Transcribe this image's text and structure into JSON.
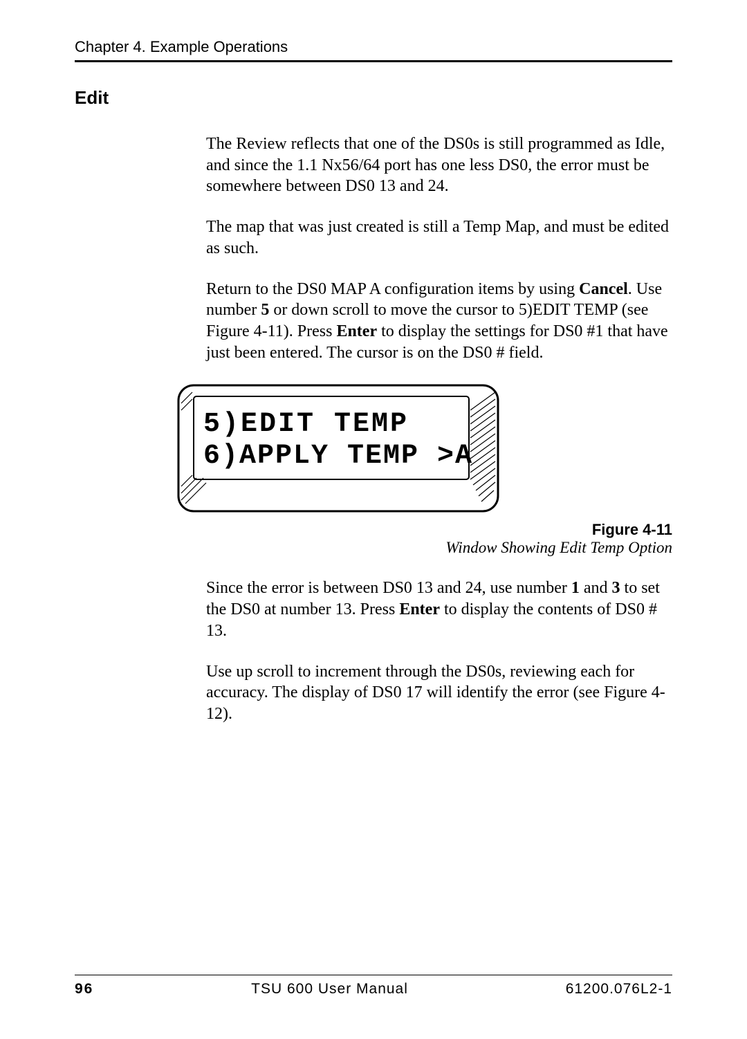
{
  "header": {
    "chapter": "Chapter 4.  Example Operations"
  },
  "section": {
    "title": "Edit"
  },
  "paragraphs": {
    "p1": "The Review reflects that one of the DS0s is still programmed as Idle, and since the 1.1 Nx56/64 port has one less DS0, the error must be somewhere between DS0 13 and 24.",
    "p2": "The map that was just created is still a Temp Map, and must be edited as such.",
    "p3_part1": "Return to the DS0 MAP A configuration items by using ",
    "p3_bold1": "Cancel",
    "p3_part2": ".  Use number ",
    "p3_bold2": "5",
    "p3_part3": " or down scroll to move the cursor to 5)EDIT TEMP (see Figure 4-11).  Press ",
    "p3_bold3": "Enter",
    "p3_part4": " to display the settings for DS0 #1 that have just been entered.  The cursor is on the DS0 # field.",
    "p4_part1": "Since the error is between DS0 13 and 24, use number ",
    "p4_bold1": "1",
    "p4_part2": " and ",
    "p4_bold2": "3",
    "p4_part3": " to set the DS0 at number 13.  Press ",
    "p4_bold3": "Enter",
    "p4_part4": " to display the contents of DS0 # 13.",
    "p5": "Use up scroll to increment through the DS0s, reviewing each for accuracy.  The display of DS0 17 will identify the error (see Figure 4-12)."
  },
  "lcd": {
    "line1": "5)EDIT TEMP",
    "line2": "6)APPLY TEMP >A"
  },
  "figure": {
    "number": "Figure 4-11",
    "title": "Window Showing Edit Temp Option"
  },
  "footer": {
    "page": "96",
    "center": "TSU 600 User Manual",
    "right": "61200.076L2-1"
  }
}
